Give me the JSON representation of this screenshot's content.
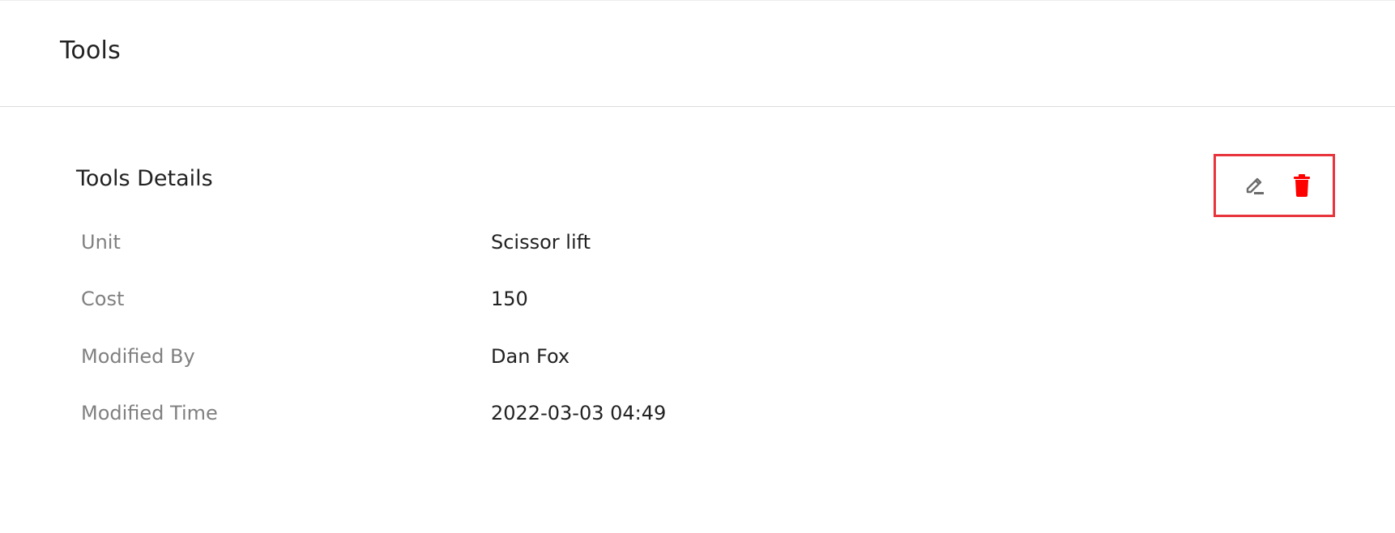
{
  "header": {
    "title": "Tools"
  },
  "card": {
    "title": "Tools Details",
    "actions": {
      "edit_icon": "edit-pencil-icon",
      "delete_icon": "trash-icon",
      "delete_color": "#ff0000",
      "edit_color": "#6b6b6b",
      "highlight_color": "#e8343c"
    },
    "rows": [
      {
        "label": "Unit",
        "value": "Scissor lift"
      },
      {
        "label": "Cost",
        "value": "150"
      },
      {
        "label": "Modified By",
        "value": "Dan Fox"
      },
      {
        "label": "Modified Time",
        "value": "2022-03-03 04:49"
      }
    ]
  }
}
